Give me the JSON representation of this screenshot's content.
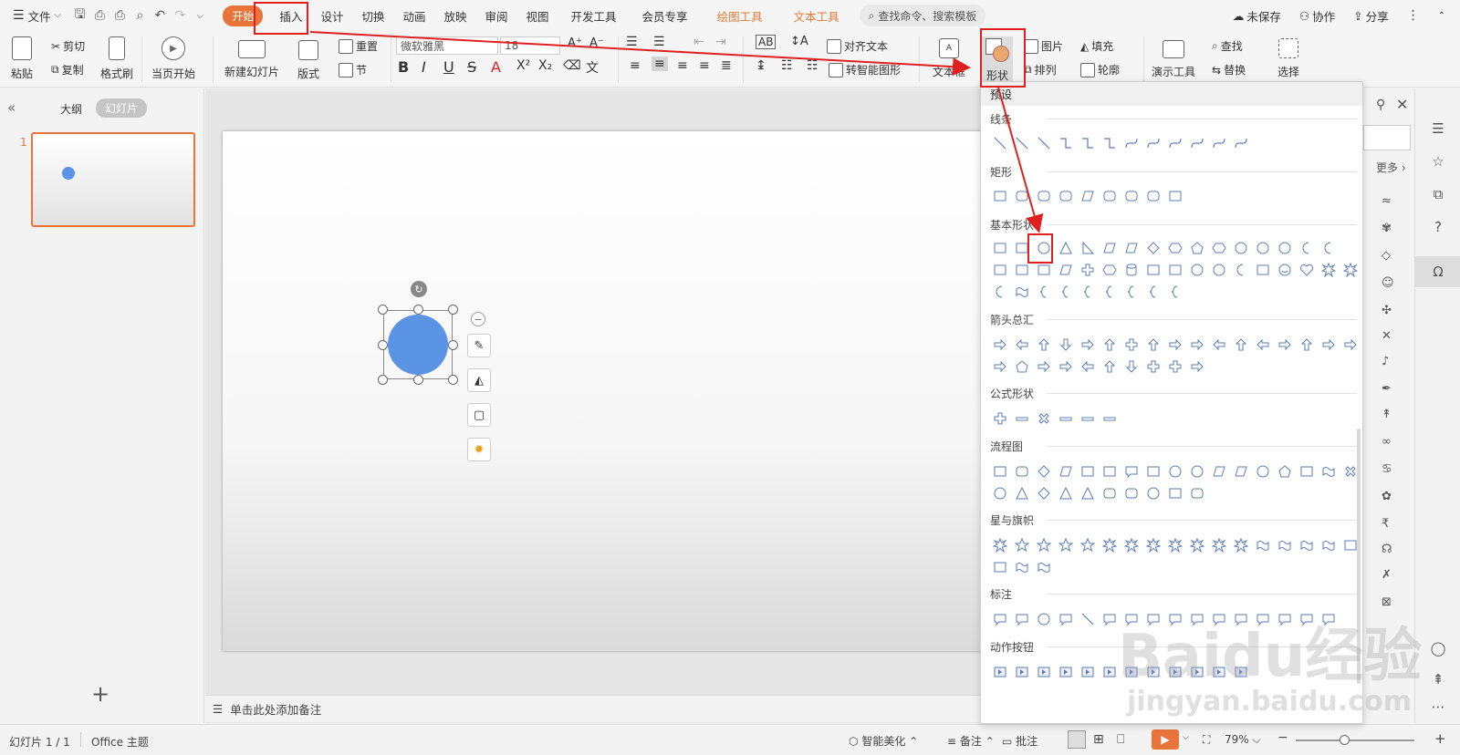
{
  "menubar": {
    "file": "文件",
    "tabs": [
      "开始",
      "插入",
      "设计",
      "切换",
      "动画",
      "放映",
      "审阅",
      "视图",
      "开发工具",
      "会员专享"
    ],
    "context_tabs": [
      "绘图工具",
      "文本工具"
    ],
    "search_placeholder": "查找命令、搜索模板",
    "unsaved": "未保存",
    "collab": "协作",
    "share": "分享"
  },
  "ribbon": {
    "paste": "粘贴",
    "cut": "剪切",
    "copy": "复制",
    "format_painter": "格式刷",
    "from_current": "当页开始",
    "new_slide": "新建幻灯片",
    "layout": "版式",
    "section": "节",
    "reset": "重置",
    "font_name": "微软雅黑",
    "font_size": "18",
    "align_text": "对齐文本",
    "smart_shape": "转智能图形",
    "textbox": "文本框",
    "shapes": "形状",
    "picture": "图片",
    "fill": "填充",
    "arrange": "排列",
    "outline": "轮廓",
    "presenter": "演示工具",
    "find": "查找",
    "replace": "替换",
    "select": "选择"
  },
  "left_panel": {
    "outline_tab": "大纲",
    "slides_tab": "幻灯片",
    "slide_number": "1",
    "add_slide": "+"
  },
  "notes_placeholder": "单击此处添加备注",
  "status": {
    "slide_counter": "幻灯片 1 / 1",
    "theme": "Office 主题",
    "smart_beautify": "智能美化",
    "notes": "备注",
    "comments": "批注",
    "zoom": "79%"
  },
  "shape_panel": {
    "header": "预设",
    "categories": [
      "线条",
      "矩形",
      "基本形状",
      "箭头总汇",
      "公式形状",
      "流程图",
      "星与旗帜",
      "标注",
      "动作按钮"
    ]
  },
  "right_strip": {
    "more": "更多"
  },
  "watermark": {
    "brand": "Baidu经验",
    "url": "jingyan.baidu.com"
  },
  "colors": {
    "accent": "#e8743b",
    "shape_fill": "#5b93e5",
    "highlight": "#e02020"
  }
}
